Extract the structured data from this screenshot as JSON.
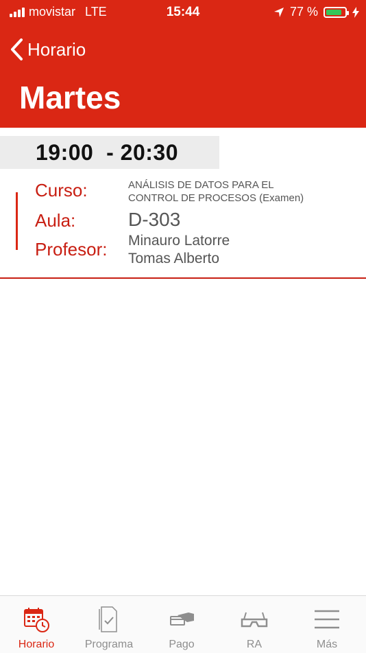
{
  "status_bar": {
    "carrier": "movistar",
    "network": "LTE",
    "time": "15:44",
    "battery_percent": "77 %",
    "battery_level": 0.77,
    "battery_color": "#35C759"
  },
  "nav": {
    "back_label": "Horario",
    "title": "Martes"
  },
  "session": {
    "start": "19:00",
    "separator": "-",
    "end": "20:30",
    "curso_label": "Curso:",
    "curso_line1": "ANÁLISIS DE DATOS PARA EL",
    "curso_line2": "CONTROL DE PROCESOS (Examen)",
    "aula_label": "Aula:",
    "aula_value": "D-303",
    "profesor_label": "Profesor:",
    "profesor_line1": "Minauro Latorre",
    "profesor_line2": "Tomas Alberto"
  },
  "tabbar": {
    "tabs": [
      {
        "label": "Horario",
        "icon": "calendar-clock-icon",
        "active": true
      },
      {
        "label": "Programa",
        "icon": "document-check-icon",
        "active": false
      },
      {
        "label": "Pago",
        "icon": "payment-hand-icon",
        "active": false
      },
      {
        "label": "RA",
        "icon": "ar-glasses-icon",
        "active": false
      },
      {
        "label": "Más",
        "icon": "menu-icon",
        "active": false
      }
    ]
  },
  "colors": {
    "brand_red": "#DA2714",
    "label_red": "#C81E12",
    "inactive_gray": "#8e8e8e"
  }
}
